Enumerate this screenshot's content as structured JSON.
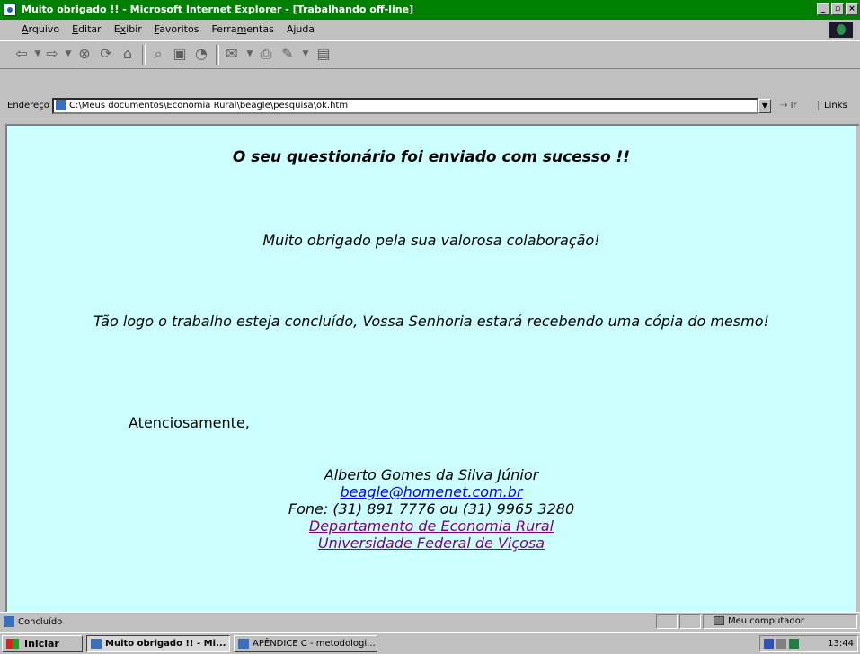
{
  "window": {
    "title": "Muito obrigado !! - Microsoft Internet Explorer - [Trabalhando off-line]"
  },
  "menu": {
    "items": [
      {
        "first": "A",
        "rest": "rquivo"
      },
      {
        "first": "E",
        "rest": "ditar"
      },
      {
        "pre": "E",
        "first": "x",
        "rest": "ibir"
      },
      {
        "first": "F",
        "rest": "avoritos"
      },
      {
        "pre": "Ferra",
        "first": "m",
        "rest": "entas"
      },
      {
        "pre": "A",
        "first": "j",
        "rest": "uda"
      }
    ]
  },
  "addressbar": {
    "label": "Endereço",
    "url": "C:\\Meus documentos\\Economia Rural\\beagle\\pesquisa\\ok.htm",
    "go": "Ir",
    "links": "Links"
  },
  "page": {
    "heading": "O seu questionário foi enviado com sucesso !!",
    "thanks": "Muito obrigado pela sua valorosa colaboração!",
    "notice": "Tão logo o trabalho esteja concluído, Vossa Senhoria estará recebendo uma cópia do mesmo!",
    "closing": "Atenciosamente,",
    "signature": {
      "name": "Alberto Gomes da Silva Júnior",
      "email": "beagle@homenet.com.br",
      "phone": "Fone: (31) 891 7776 ou (31) 9965 3280",
      "department": "Departamento de Economia Rural",
      "university": "Universidade Federal de Viçosa"
    }
  },
  "statusbar": {
    "status": "Concluído",
    "zone": "Meu computador"
  },
  "taskbar": {
    "start": "Iniciar",
    "tasks": [
      "Muito obrigado !! - Mi...",
      "APÊNDICE C - metodologi..."
    ],
    "clock": "13:44"
  },
  "colors": {
    "titlebar": "#008000",
    "page_background": "#ccffff",
    "link": "#0000ee",
    "visited_link": "#800080"
  }
}
